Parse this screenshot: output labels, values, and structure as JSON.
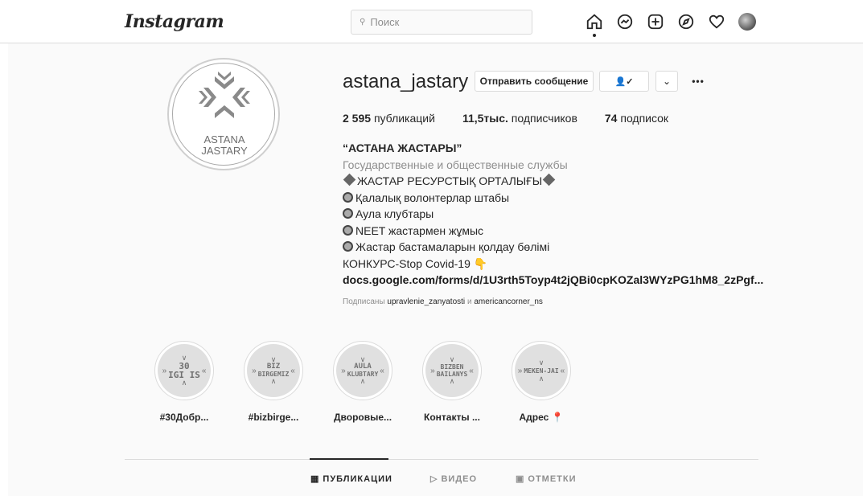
{
  "header": {
    "logo": "Instagram",
    "search_placeholder": "Поиск"
  },
  "profile": {
    "avatar_text_line1": "ASTANA",
    "avatar_text_line2": "JASTARY",
    "username": "astana_jastary",
    "message_button": "Отправить сообщение",
    "follow_icon_label": "👤✓",
    "dropdown_label": "⌄",
    "more_label": "•••",
    "stats": {
      "posts_count": "2 595",
      "posts_label": "публикаций",
      "followers_count": "11,5тыс.",
      "followers_label": "подписчиков",
      "following_count": "74",
      "following_label": "подписок"
    },
    "bio": {
      "name": "“АСТАНА ЖАСТАРЫ”",
      "category": "Государственные и общественные службы",
      "line1": "ЖАСТАР РЕСУРСТЫҚ ОРТАЛЫҒЫ",
      "line2": "Қалалық волонтерлар штабы",
      "line3": "Аула клубтары",
      "line4": "NEET жастармен жұмыс",
      "line5": "Жастар бастамаларын қолдау бөлімі",
      "line6": "КОНКУРС-Stop Covid-19 👇",
      "link": "docs.google.com/forms/d/1U3rth5Toyp4t2jQBi0cpKOZal3WYzPG1hM8_2zPgf..."
    },
    "followed_by": {
      "prefix": "Подписаны",
      "user1": "upravlenie_zanyatosti",
      "conj": "и",
      "user2": "americancorner_ns"
    }
  },
  "highlights": [
    {
      "cover_line1": "30",
      "cover_line2": "IGI IS",
      "label": "#30Добр..."
    },
    {
      "cover_line1": "BIZ",
      "cover_line2": "BIRGEMIZ",
      "label": "#bizbirge..."
    },
    {
      "cover_line1": "AULA",
      "cover_line2": "KLUBTARY",
      "label": "Дворовые..."
    },
    {
      "cover_line1": "BIZBEN",
      "cover_line2": "BAILANYS",
      "label": "Контакты ..."
    },
    {
      "cover_line1": "MEKEN-JAI",
      "cover_line2": "",
      "label": "Адрес 📍"
    }
  ],
  "tabs": {
    "posts": "ПУБЛИКАЦИИ",
    "video": "ВИДЕО",
    "tagged": "ОТМЕТКИ"
  }
}
